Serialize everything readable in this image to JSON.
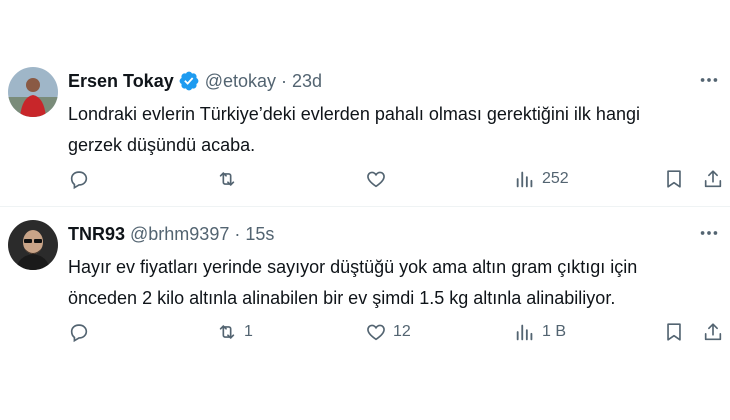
{
  "tweets": [
    {
      "name": "Ersen Tokay",
      "handle": "@etokay",
      "dot": "·",
      "time": "23d",
      "verified": true,
      "text": "Londraki evlerin Türkiye’deki evlerden pahalı olması gerektiğini ilk hangi\ngerzek düşündü acaba.",
      "reply_count": "",
      "retweet_count": "",
      "like_count": "",
      "view_count": "252"
    },
    {
      "name": "TNR93",
      "handle": "@brhm9397",
      "dot": "·",
      "time": "15s",
      "verified": false,
      "text": "Hayır ev fiyatları yerinde sayıyor düştüğü yok ama altın gram çıktıgı için\nönceden 2 kilo altınla alinabilen bir ev şimdi 1.5 kg altınla alinabiliyor.",
      "reply_count": "",
      "retweet_count": "1",
      "like_count": "12",
      "view_count": "1 B"
    }
  ],
  "colors": {
    "verified": "#1d9bf0",
    "secondary_text": "#536471",
    "divider": "#eff3f4"
  }
}
